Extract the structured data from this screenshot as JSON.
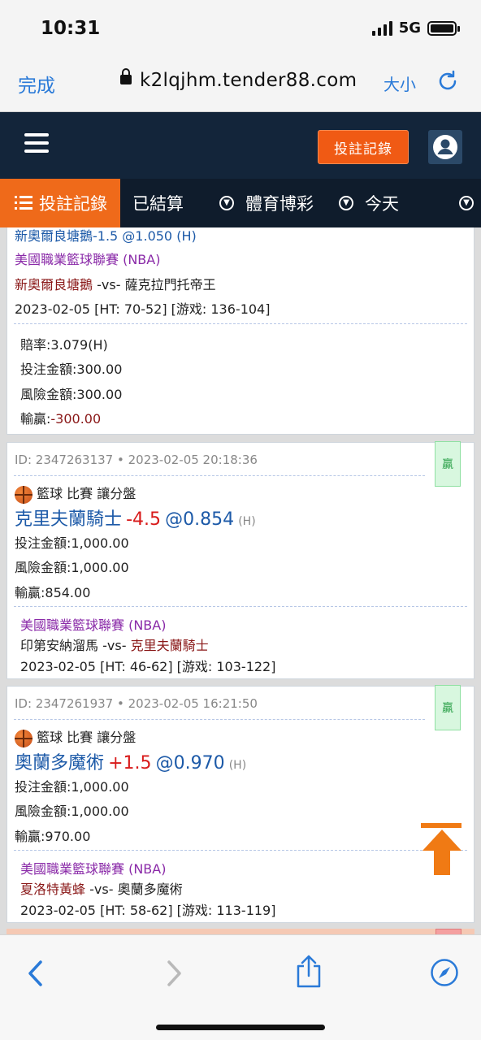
{
  "status_bar": {
    "time": "10:31",
    "network": "5G"
  },
  "browser": {
    "done_label": "完成",
    "url": "k2lqjhm.tender88.com",
    "text_size_label": "大小"
  },
  "header": {
    "bet_record_button": "投註記錄"
  },
  "tabs": {
    "active": "投註記錄",
    "settled": "已結算",
    "sports": "體育博彩",
    "today": "今天"
  },
  "card0": {
    "partial_top": "新奧爾良塘鵝-1.5 @1.050 (H)",
    "league": "美國職業籃球聯賽 (NBA)",
    "team_a": "新奧爾良塘鵝",
    "vs": "-vs-",
    "team_b": "薩克拉門托帝王",
    "result": "2023-02-05 [HT: 70-52] [游戏: 136-104]",
    "odds": "賠率:3.079(H)",
    "stake": "投注金額:300.00",
    "risk": "風險金額:300.00",
    "winloss_label": "輸贏:",
    "winloss_value": "-300.00"
  },
  "card1": {
    "id_line": "ID: 2347263137 • 2023-02-05 20:18:36",
    "status": "贏",
    "sport_line": "籃球 比賽 讓分盤",
    "team": "克里夫蘭騎士",
    "handicap": "-4.5",
    "price": "@0.854",
    "side": "(H)",
    "stake": "投注金額:1,000.00",
    "risk": "風險金額:1,000.00",
    "winloss": "輸贏:854.00",
    "league": "美國職業籃球聯賽 (NBA)",
    "team_a": "印第安納溜馬",
    "vs": "-vs-",
    "team_b": "克里夫蘭騎士",
    "result": "2023-02-05 [HT: 46-62] [游戏: 103-122]"
  },
  "card2": {
    "id_line": "ID: 2347261937 • 2023-02-05 16:21:50",
    "status": "贏",
    "sport_line": "籃球 比賽 讓分盤",
    "team": "奧蘭多魔術",
    "handicap": "+1.5",
    "price": "@0.970",
    "side": "(H)",
    "stake": "投注金額:1,000.00",
    "risk": "風險金額:1,000.00",
    "winloss": "輸贏:970.00",
    "league": "美國職業籃球聯賽 (NBA)",
    "team_a": "夏洛特黃蜂",
    "vs": "-vs-",
    "team_b": "奧蘭多魔術",
    "result": "2023-02-05 [HT: 58-62] [游戏: 113-119]"
  },
  "colors": {
    "orange": "#ef6a1a",
    "navy": "#13253a",
    "win_green": "#2ba049"
  }
}
